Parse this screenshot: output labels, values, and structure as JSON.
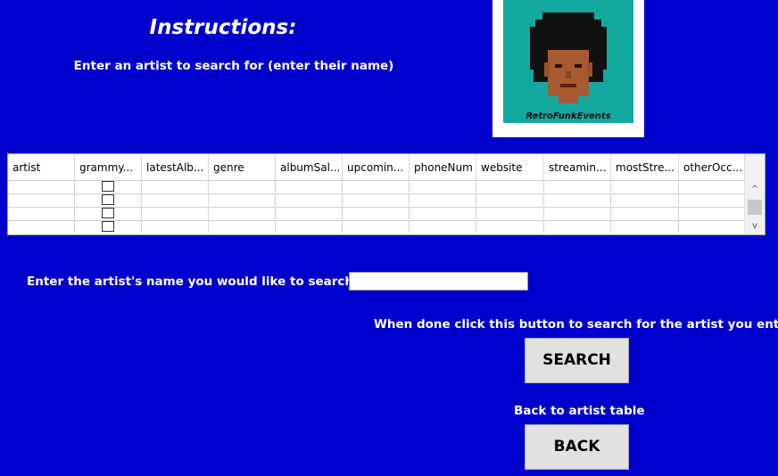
{
  "instructions": {
    "title": "Instructions:",
    "subtitle": "Enter an artist to search for (enter their name)"
  },
  "logo": {
    "caption": "RetroFunkEvents"
  },
  "table": {
    "columns": [
      "artist",
      "grammy...",
      "latestAlb...",
      "genre",
      "albumSal...",
      "upcomin...",
      "phoneNum",
      "website",
      "streamin...",
      "mostStre...",
      "otherOcc..."
    ],
    "scroll_up": "^",
    "scroll_down": "v"
  },
  "search": {
    "label": "Enter the artist's name you would like to search for:",
    "value": "",
    "hint": "When done click this button to search for the artist you entered",
    "button": "SEARCH"
  },
  "back": {
    "label": "Back to artist table",
    "button": "BACK"
  },
  "colors": {
    "background": "#0000cc",
    "logo_bg": "#13a8a0"
  }
}
